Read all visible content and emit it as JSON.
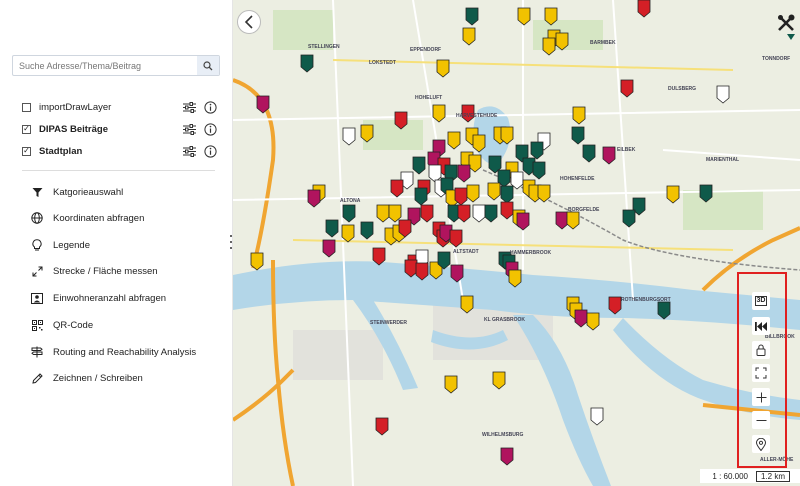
{
  "search": {
    "placeholder": "Suche Adresse/Thema/Beitrag",
    "icon": "search-icon"
  },
  "layers": [
    {
      "label": "importDrawLayer",
      "checked": false,
      "bold": false
    },
    {
      "label": "DIPAS Beiträge",
      "checked": true,
      "bold": true
    },
    {
      "label": "Stadtplan",
      "checked": true,
      "bold": true
    }
  ],
  "tools": [
    {
      "label": "Katgorieauswahl",
      "icon": "filter-icon"
    },
    {
      "label": "Koordinaten abfragen",
      "icon": "globe-icon"
    },
    {
      "label": "Legende",
      "icon": "lightbulb-icon"
    },
    {
      "label": "Strecke / Fläche messen",
      "icon": "measure-arrows-icon"
    },
    {
      "label": "Einwohneranzahl abfragen",
      "icon": "population-icon"
    },
    {
      "label": "QR-Code",
      "icon": "qr-code-icon"
    },
    {
      "label": "Routing and Reachability Analysis",
      "icon": "signpost-icon"
    },
    {
      "label": "Zeichnen / Schreiben",
      "icon": "pencil-icon"
    }
  ],
  "map_controls": {
    "btn_3d": "3D",
    "scale_ratio": "1 : 60.000",
    "scale_distance": "1.2 km"
  },
  "map_labels": {
    "district_1": "EPPENDORF",
    "district_2": "BARMBEK",
    "district_3": "HOHELUFT",
    "district_4": "ALTONA",
    "district_5": "ALTSTADT",
    "district_6": "HAMMERBROOK",
    "district_7": "ROTHENBURGSORT",
    "district_8": "WILHELMSBURG",
    "district_9": "STEINWERDER",
    "district_10": "KL GRASBROOK",
    "district_11": "HOHENFELDE",
    "district_12": "BORGFELDE",
    "district_13": "EILBEK",
    "district_14": "MARIENTHAL",
    "district_15": "STELLINGEN",
    "district_16": "DULSBERG",
    "district_17": "BILLBROOK",
    "district_18": "ALLER-MÖHE",
    "district_19": "TONNDORF",
    "district_20": "HARVESTEHUDE",
    "district_21": "LOKSTEDT"
  },
  "colors": {
    "pin_yellow": "#f2c200",
    "pin_red": "#d41f26",
    "pin_magenta": "#b0145e",
    "pin_teal": "#0f5a4a",
    "pin_white": "#ffffff",
    "water": "#b3d6e8",
    "highway": "#f0a531",
    "highlight": "#e02020"
  }
}
